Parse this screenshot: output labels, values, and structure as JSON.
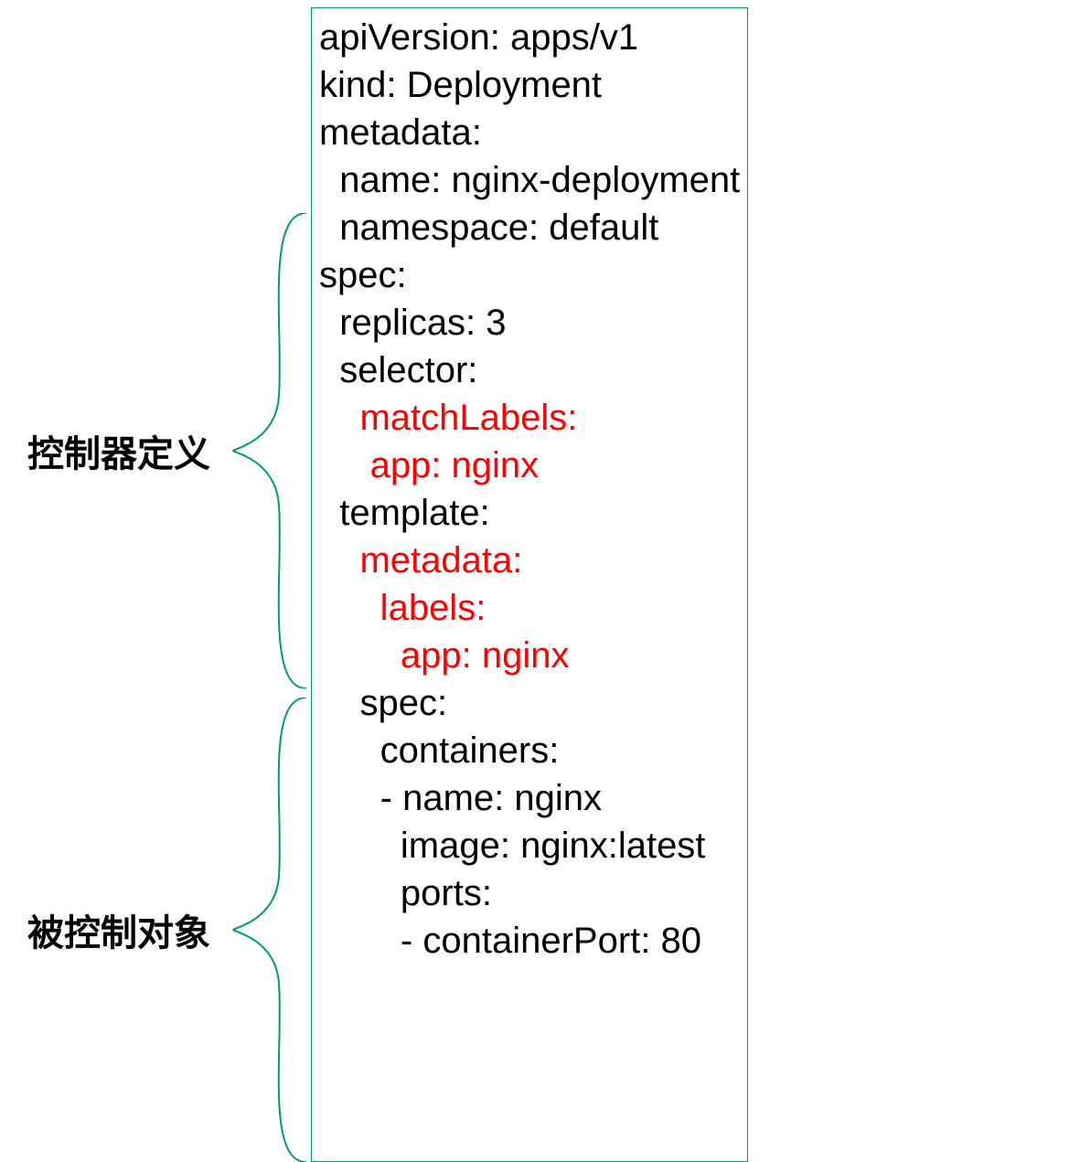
{
  "labels": {
    "controller": "控制器定义",
    "controlled": "被控制对象"
  },
  "yaml": {
    "l1": "apiVersion: apps/v1",
    "l2": "kind: Deployment",
    "l3": "metadata:",
    "l4": "  name: nginx-deployment",
    "l5": "  namespace: default",
    "l6": "spec:",
    "l7": "  replicas: 3",
    "l8": "  selector:",
    "l9": "    matchLabels:",
    "l10": "     app: nginx",
    "l11": "  template:",
    "l12": "    metadata:",
    "l13": "      labels:",
    "l14": "        app: nginx",
    "l15": "    spec:",
    "l16": "      containers:",
    "l17": "      - name: nginx",
    "l18": "        image: nginx:latest",
    "l19": "        ports:",
    "l20": "        - containerPort: 80"
  }
}
